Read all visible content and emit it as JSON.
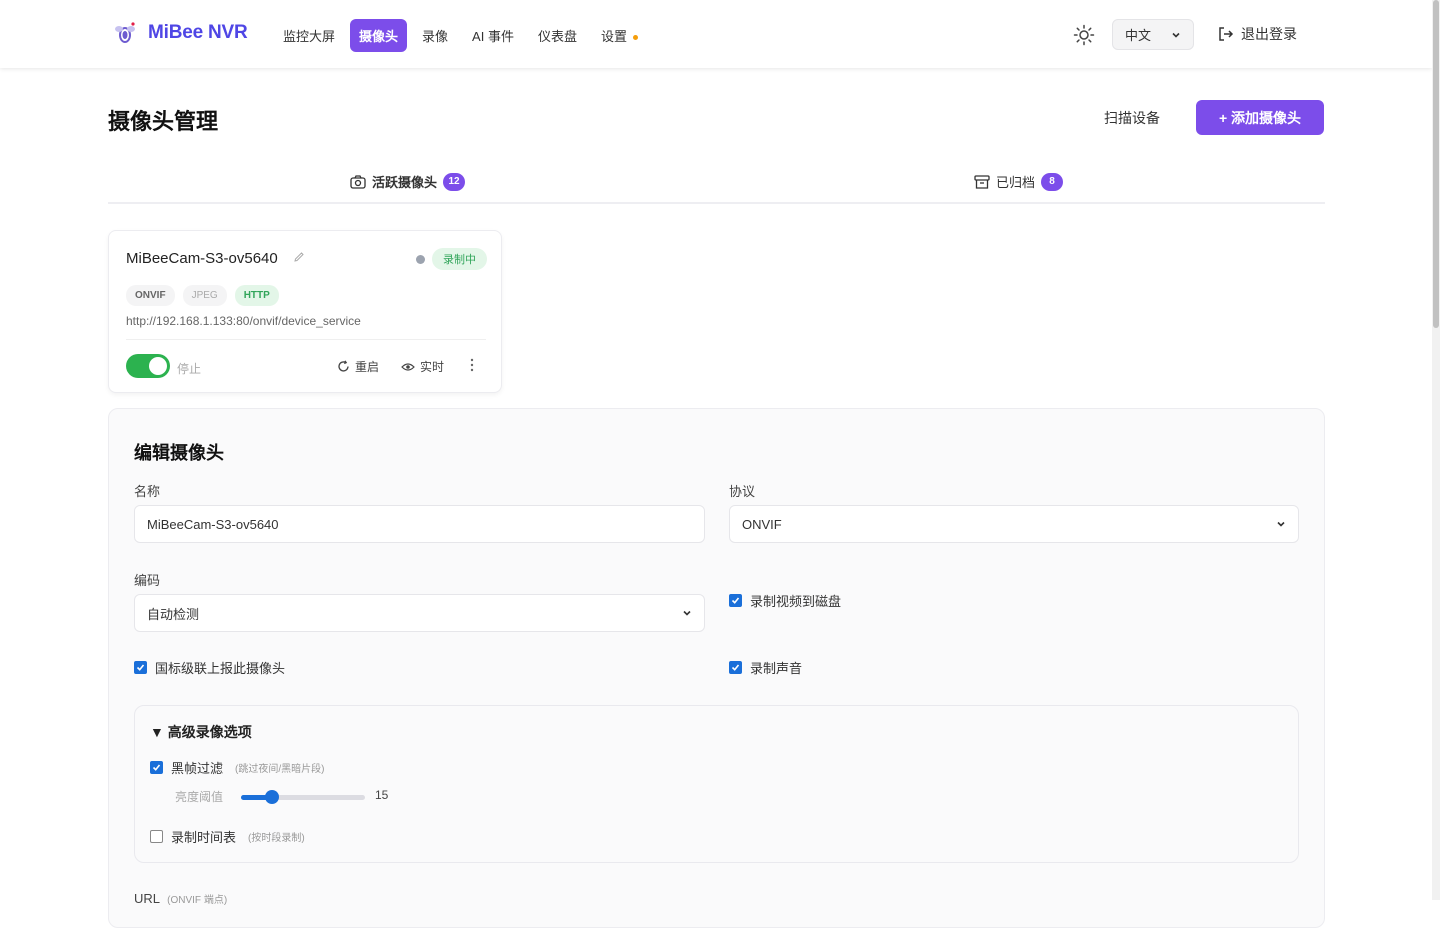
{
  "app": {
    "name": "MiBee NVR"
  },
  "nav": {
    "items": [
      {
        "label": "监控大屏",
        "active": false
      },
      {
        "label": "摄像头",
        "active": true
      },
      {
        "label": "录像",
        "active": false
      },
      {
        "label": "AI 事件",
        "active": false
      },
      {
        "label": "仪表盘",
        "active": false
      },
      {
        "label": "设置",
        "active": false,
        "dot_color": "#f59e0b"
      }
    ],
    "language": "中文",
    "logout_label": "退出登录"
  },
  "page": {
    "title": "摄像头管理",
    "scan_label": "扫描设备",
    "add_label": "+ 添加摄像头"
  },
  "tabs": {
    "active": {
      "label": "活跃摄像头",
      "count": "12"
    },
    "archived": {
      "label": "已归档",
      "count": "8"
    }
  },
  "camera_card": {
    "name": "MiBeeCam-S3-ov5640",
    "status_badge": "录制中",
    "tags": [
      "ONVIF",
      "JPEG",
      "HTTP"
    ],
    "url": "http://192.168.1.133:80/onvif/device_service",
    "toggle_on": true,
    "stop_label": "停止",
    "restart_label": "重启",
    "live_label": "实时"
  },
  "edit_form": {
    "title": "编辑摄像头",
    "name_label": "名称",
    "name_value": "MiBeeCam-S3-ov5640",
    "protocol_label": "协议",
    "protocol_value": "ONVIF",
    "codec_label": "编码",
    "codec_value": "自动检测",
    "record_to_disk_label": "录制视频到磁盘",
    "record_to_disk": true,
    "gb_report_label": "国标级联上报此摄像头",
    "gb_report": true,
    "record_audio_label": "录制声音",
    "record_audio": true,
    "advanced": {
      "title": "▼ 高级录像选项",
      "black_frame_label": "黑帧过滤",
      "black_frame_hint": "(跳过夜间/黑暗片段)",
      "black_frame": true,
      "brightness_label": "亮度阈值",
      "brightness_value": "15",
      "brightness_fraction": 0.25,
      "schedule_label": "录制时间表",
      "schedule_hint": "(按时段录制)",
      "schedule": false
    },
    "url_label": "URL",
    "url_hint": "(ONVIF 端点)"
  }
}
